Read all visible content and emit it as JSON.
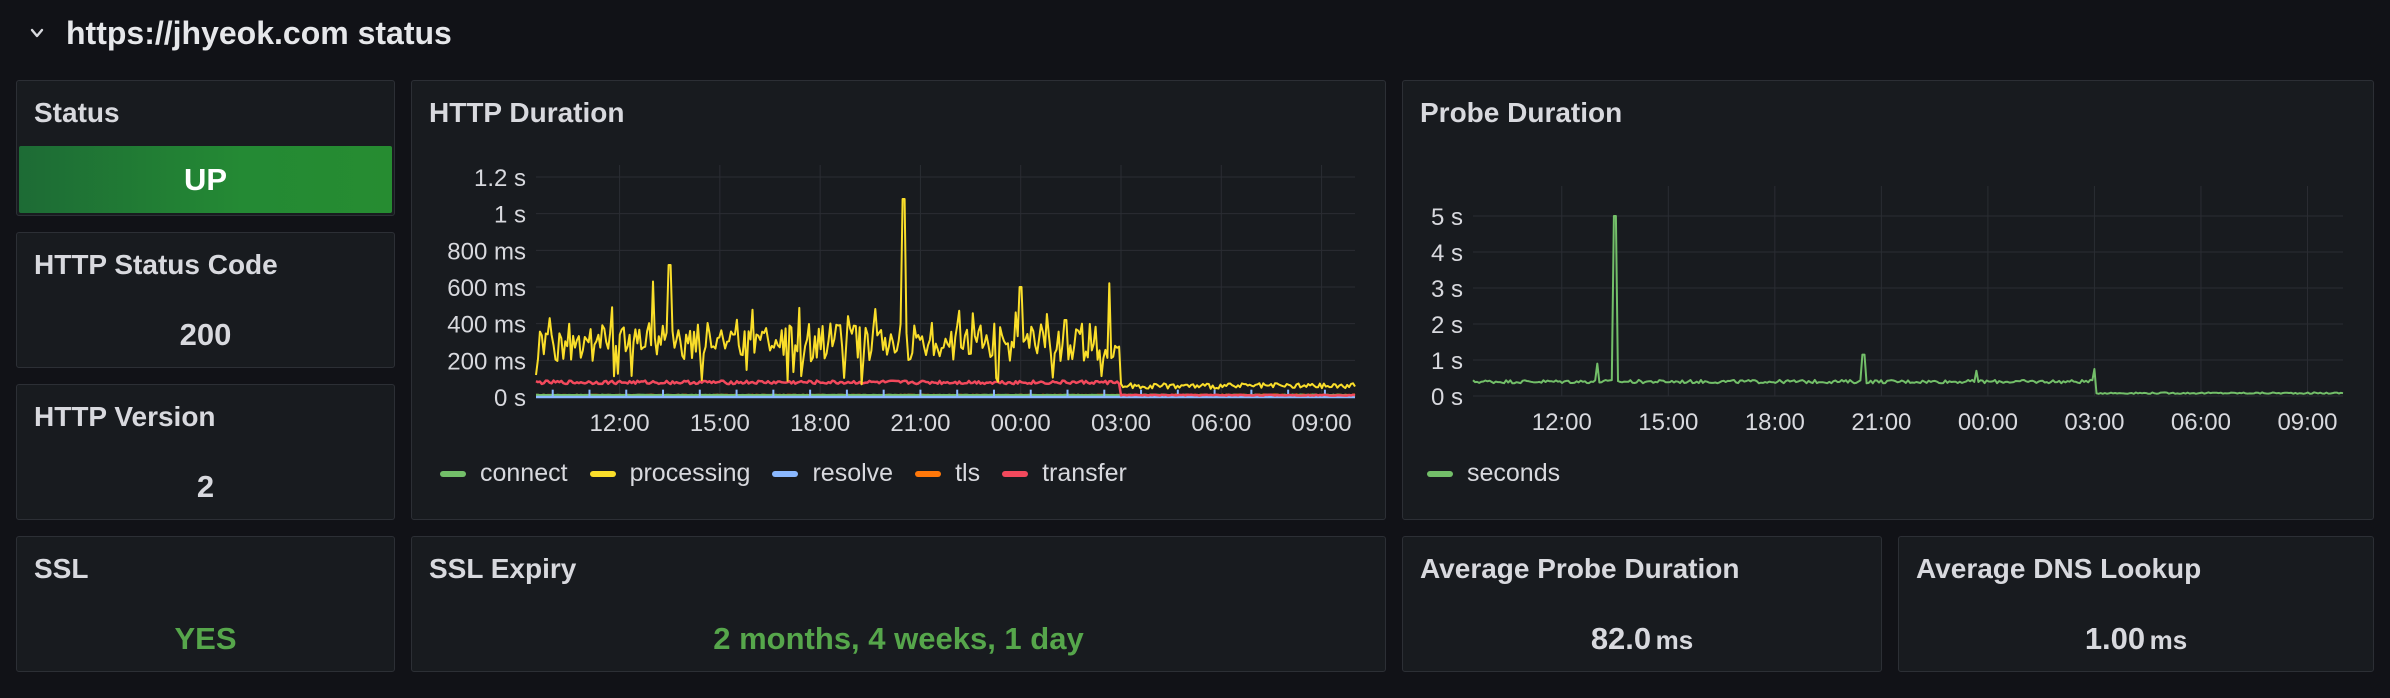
{
  "row": {
    "title": "https://jhyeok.com status",
    "icon": "chevron-down-icon"
  },
  "panels": {
    "status": {
      "title": "Status",
      "value": "UP",
      "color": "#248a34"
    },
    "http_status_code": {
      "title": "HTTP Status Code",
      "value": "200"
    },
    "http_version": {
      "title": "HTTP Version",
      "value": "2"
    },
    "ssl": {
      "title": "SSL",
      "value": "YES",
      "color": "#56a64b"
    },
    "ssl_expiry": {
      "title": "SSL Expiry",
      "value": "2 months, 4 weeks, 1 day",
      "color": "#56a64b"
    },
    "avg_probe_duration": {
      "title": "Average Probe Duration",
      "value": "82.0",
      "unit": "ms"
    },
    "avg_dns_lookup": {
      "title": "Average DNS Lookup",
      "value": "1.00",
      "unit": "ms"
    }
  },
  "chart_data": [
    {
      "type": "line",
      "title": "HTTP Duration",
      "x_ticks": [
        "12:00",
        "15:00",
        "18:00",
        "21:00",
        "00:00",
        "03:00",
        "06:00",
        "09:00"
      ],
      "y_ticks": [
        "0 s",
        "200 ms",
        "400 ms",
        "600 ms",
        "800 ms",
        "1 s",
        "1.2 s"
      ],
      "ylim": [
        0,
        1.2
      ],
      "y_unit": "s",
      "grid": true,
      "legend_position": "bottom-left",
      "series": [
        {
          "name": "connect",
          "color": "#73bf69",
          "level_before": 0.01,
          "level_after": 0.01
        },
        {
          "name": "processing",
          "color": "#fade2a",
          "level_before": 0.3,
          "level_after": 0.06,
          "spikes": [
            [
              "10:30",
              0.4
            ],
            [
              "13:00",
              0.63
            ],
            [
              "13:30",
              0.72
            ],
            [
              "19:40",
              0.48
            ],
            [
              "20:30",
              1.08
            ],
            [
              "22:10",
              0.47
            ],
            [
              "00:00",
              0.6
            ],
            [
              "01:20",
              0.42
            ],
            [
              "02:40",
              0.62
            ],
            [
              "09:30",
              0.12
            ]
          ]
        },
        {
          "name": "resolve",
          "color": "#8ab8ff",
          "level_before": 0.0,
          "level_after": 0.0
        },
        {
          "name": "tls",
          "color": "#ff780a",
          "level_before": 0.01,
          "level_after": 0.01
        },
        {
          "name": "transfer",
          "color": "#f2495c",
          "level_before": 0.08,
          "level_after": 0.01
        }
      ]
    },
    {
      "type": "line",
      "title": "Probe Duration",
      "x_ticks": [
        "12:00",
        "15:00",
        "18:00",
        "21:00",
        "00:00",
        "03:00",
        "06:00",
        "09:00"
      ],
      "y_ticks": [
        "0 s",
        "1 s",
        "2 s",
        "3 s",
        "4 s",
        "5 s"
      ],
      "ylim": [
        0,
        5.5
      ],
      "y_unit": "s",
      "grid": true,
      "legend_position": "bottom-left",
      "series": [
        {
          "name": "seconds",
          "color": "#73bf69",
          "level_before": 0.4,
          "level_after": 0.08,
          "spikes": [
            [
              "13:00",
              0.9
            ],
            [
              "13:30",
              5.0
            ],
            [
              "20:30",
              1.15
            ],
            [
              "23:40",
              0.7
            ],
            [
              "03:00",
              0.75
            ]
          ]
        }
      ]
    }
  ]
}
